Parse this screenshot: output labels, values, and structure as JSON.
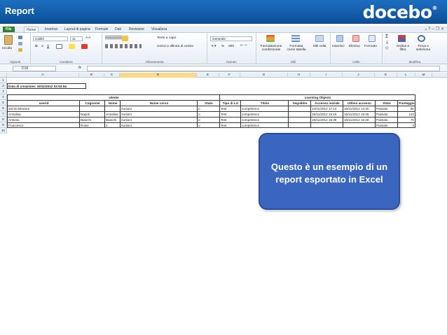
{
  "slide": {
    "title": "Report",
    "logo": "docebo",
    "logo_mark": "®"
  },
  "callout": {
    "line1": "Questo è un esempio di un",
    "line2": "report esportato in Excel"
  },
  "excel": {
    "tabs": [
      "File",
      "Home",
      "Inserisci",
      "Layout di pagina",
      "Formule",
      "Dati",
      "Revisione",
      "Visualizza"
    ],
    "ribbon": {
      "paste": "Incolla",
      "clipboard_group": "Appunti",
      "font_name": "Calibri",
      "font_size": "11",
      "font_group": "Carattere",
      "wrap_text": "Testo a capo",
      "merge_center": "Unisci e allinea al centro",
      "alignment_group": "Allineamento",
      "number_format": "Generale",
      "number_group": "Numeri",
      "conditional_formatting": "Formattazione condizionale",
      "format_table": "Formatta come tabella",
      "cell_styles": "Stili cella",
      "styles_group": "Stili",
      "insert": "Inserisci",
      "delete": "Elimina",
      "format": "Formato",
      "cells_group": "Celle",
      "sort_filter": "Ordina e filtra",
      "find_select": "Trova e seleziona",
      "editing_group": "Modifica",
      "bold": "G",
      "italic": "C",
      "underline": "S",
      "percent": "%",
      "thousands": "000"
    },
    "name_box": "D18",
    "fx": "fx",
    "columns": [
      "A",
      "B",
      "C",
      "D",
      "E",
      "F",
      "G",
      "H",
      "I",
      "J",
      "K",
      "L",
      "M"
    ],
    "rows": [
      "1",
      "2",
      "3",
      "4",
      "5",
      "6",
      "7",
      "8",
      "9",
      "10"
    ],
    "creation_label": "Data di creazione: 16/11/2012 03:53:54",
    "group_headers": {
      "utente": "Utente",
      "learning_objects": "Learning Objects"
    },
    "headers": [
      "userid",
      "Cognome",
      "Nome",
      "Nome corso",
      "Stato",
      "Tipo di LO",
      "Titolo",
      "Seguiblre",
      "Accesso iniziale",
      "Ultimo accesso",
      "Stato",
      "Punteggio"
    ],
    "data_rows": [
      [
        "amministratore",
        "",
        "",
        "riunioni",
        "o",
        "Test",
        "competence",
        "-",
        "14/11/2012 17:14",
        "16/11/2012 14:40",
        "Passato",
        "90"
      ],
      [
        "Annalisa",
        "Napoli",
        "Annalisa",
        "riunioni",
        "o",
        "Test",
        "competence",
        "-",
        "15/11/2012 15:18",
        "15/11/2012 15:45",
        "Passato",
        "110"
      ],
      [
        "Antonio",
        "Bianchi",
        "Bianchi",
        "riunioni",
        "o",
        "Test",
        "competence",
        "-",
        "15/11/2012 15:38",
        "15/11/2012 15:46",
        "Passato",
        "70"
      ],
      [
        "Francesco",
        "Rossi",
        "o",
        "riunioni",
        "o",
        "Test",
        "competence",
        "-",
        "",
        "",
        "Passato",
        "0"
      ]
    ]
  }
}
